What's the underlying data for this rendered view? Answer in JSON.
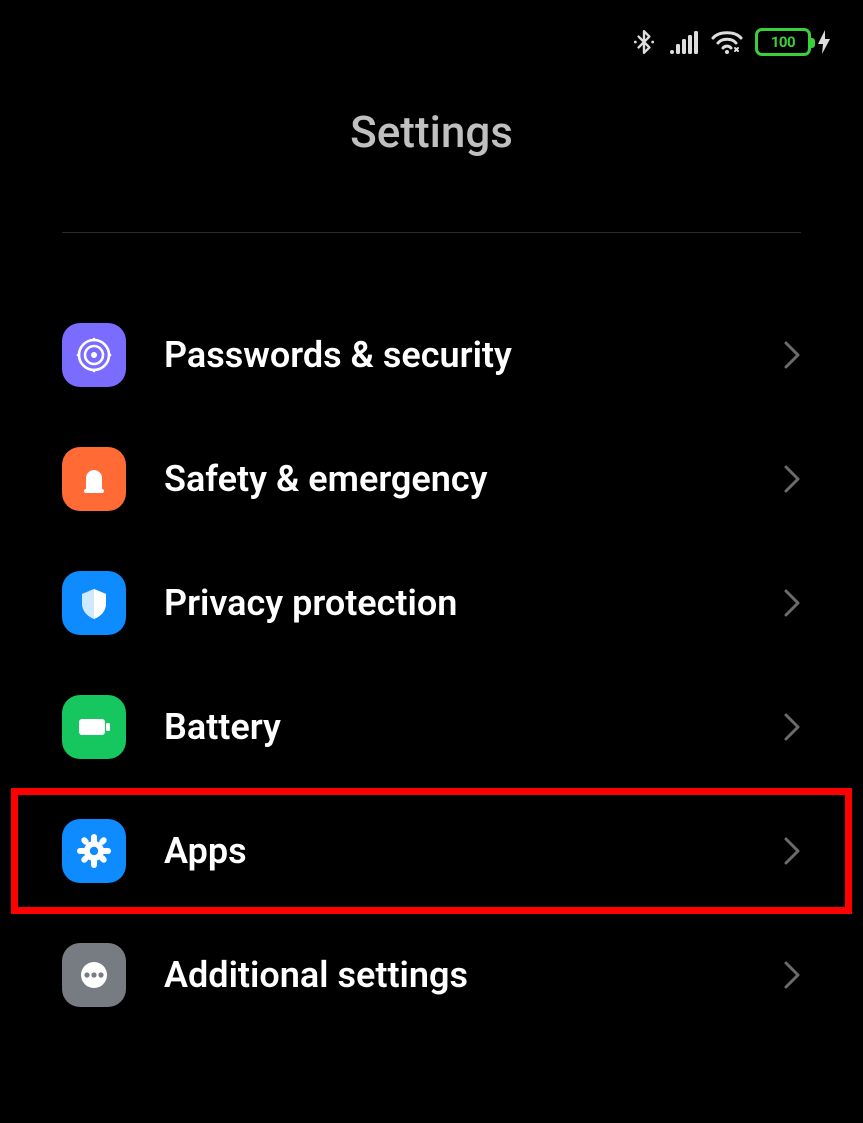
{
  "statusbar": {
    "battery_percent": "100"
  },
  "header": {
    "title": "Settings"
  },
  "items": [
    {
      "label": "Passwords & security"
    },
    {
      "label": "Safety & emergency"
    },
    {
      "label": "Privacy protection"
    },
    {
      "label": "Battery"
    },
    {
      "label": "Apps"
    },
    {
      "label": "Additional settings"
    }
  ]
}
